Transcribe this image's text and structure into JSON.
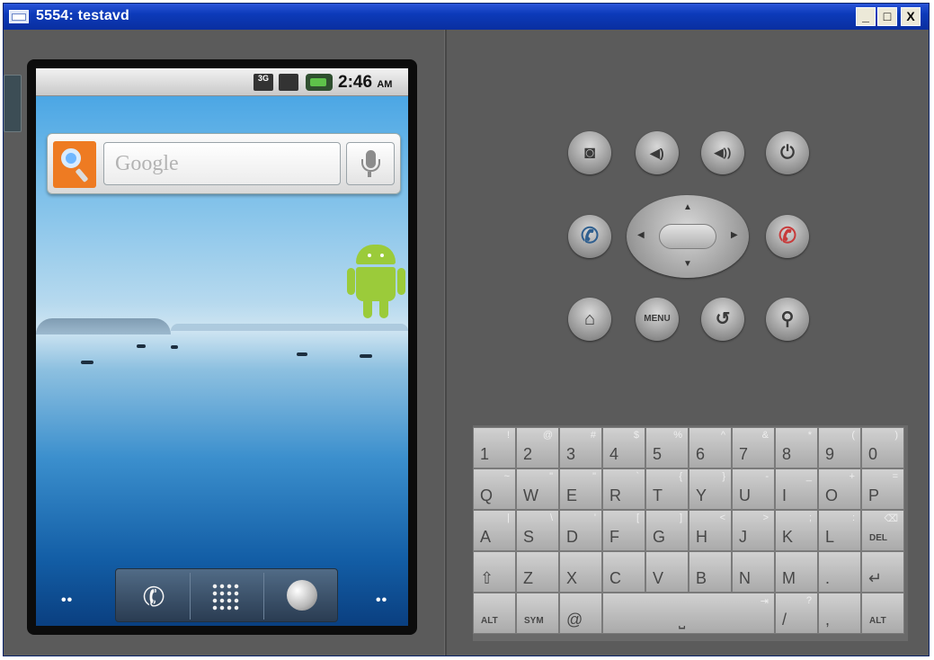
{
  "window": {
    "title": "5554: testavd",
    "minimize": "_",
    "maximize": "□",
    "close": "X"
  },
  "statusbar": {
    "time": "2:46",
    "ampm": "AM",
    "sig_label": "3G"
  },
  "search_widget": {
    "placeholder": "Google"
  },
  "dock": {
    "phone_glyph": "✆"
  },
  "page_dots": "••",
  "controls": {
    "camera": "◙",
    "vol_down": "◀)",
    "vol_up": "◀))",
    "power": "⏻",
    "call": "✆",
    "end": "✆",
    "home": "⌂",
    "menu": "MENU",
    "back": "↺",
    "search": "⚲",
    "dpad_up": "▲",
    "dpad_down": "▼",
    "dpad_left": "◀",
    "dpad_right": "▶"
  },
  "keyboard": {
    "rows": [
      [
        {
          "k": "1",
          "s": "!"
        },
        {
          "k": "2",
          "s": "@"
        },
        {
          "k": "3",
          "s": "#"
        },
        {
          "k": "4",
          "s": "$"
        },
        {
          "k": "5",
          "s": "%"
        },
        {
          "k": "6",
          "s": "^"
        },
        {
          "k": "7",
          "s": "&"
        },
        {
          "k": "8",
          "s": "*"
        },
        {
          "k": "9",
          "s": "("
        },
        {
          "k": "0",
          "s": ")"
        }
      ],
      [
        {
          "k": "Q",
          "s": "~"
        },
        {
          "k": "W",
          "s": "\""
        },
        {
          "k": "E",
          "s": "\""
        },
        {
          "k": "R",
          "s": "`"
        },
        {
          "k": "T",
          "s": "{"
        },
        {
          "k": "Y",
          "s": "}"
        },
        {
          "k": "U",
          "s": "-"
        },
        {
          "k": "I",
          "s": "_"
        },
        {
          "k": "O",
          "s": "+"
        },
        {
          "k": "P",
          "s": "="
        }
      ],
      [
        {
          "k": "A",
          "s": "|"
        },
        {
          "k": "S",
          "s": "\\"
        },
        {
          "k": "D",
          "s": "'"
        },
        {
          "k": "F",
          "s": "["
        },
        {
          "k": "G",
          "s": "]"
        },
        {
          "k": "H",
          "s": "<"
        },
        {
          "k": "J",
          "s": ">"
        },
        {
          "k": "K",
          "s": ";"
        },
        {
          "k": "L",
          "s": ":"
        },
        {
          "k": "DEL",
          "s": "⌫"
        }
      ],
      [
        {
          "k": "⇧",
          "s": ""
        },
        {
          "k": "Z",
          "s": ""
        },
        {
          "k": "X",
          "s": ""
        },
        {
          "k": "C",
          "s": ""
        },
        {
          "k": "V",
          "s": ""
        },
        {
          "k": "B",
          "s": ""
        },
        {
          "k": "N",
          "s": ""
        },
        {
          "k": "M",
          "s": ""
        },
        {
          "k": ".",
          "s": ""
        },
        {
          "k": "↵",
          "s": ""
        }
      ],
      [
        {
          "k": "ALT",
          "s": ""
        },
        {
          "k": "SYM",
          "s": ""
        },
        {
          "k": "@",
          "s": ""
        },
        {
          "k": "⎵",
          "s": "⇥"
        },
        {
          "k": "/",
          "s": "?"
        },
        {
          "k": ",",
          "s": ""
        },
        {
          "k": "ALT",
          "s": ""
        }
      ]
    ]
  }
}
